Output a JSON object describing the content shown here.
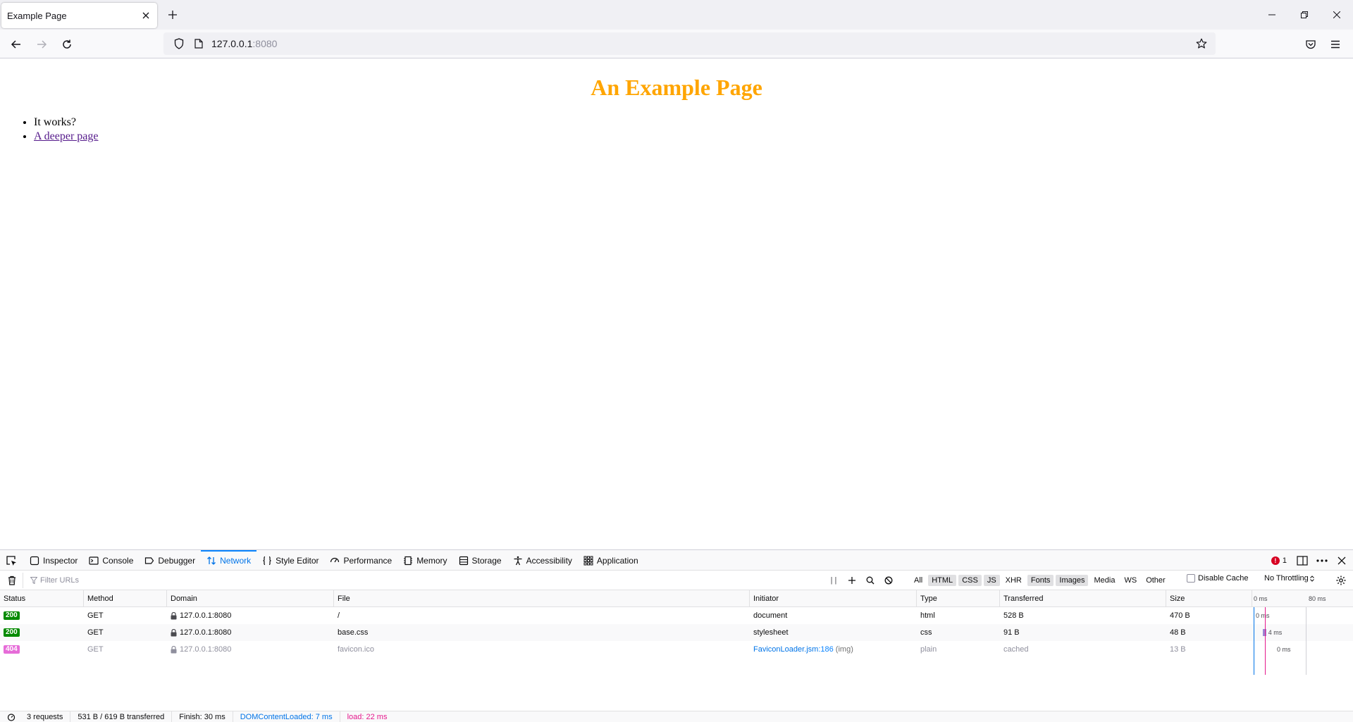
{
  "browser": {
    "tab_title": "Example Page",
    "url_host": "127.0.0.1",
    "url_port": ":8080"
  },
  "page": {
    "heading": "An Example Page",
    "items": [
      "It works?",
      "A deeper page"
    ],
    "heading_color": "#ffa500"
  },
  "devtools": {
    "tabs": [
      {
        "label": "Inspector",
        "icon": "inspector-icon"
      },
      {
        "label": "Console",
        "icon": "console-icon"
      },
      {
        "label": "Debugger",
        "icon": "debugger-icon"
      },
      {
        "label": "Network",
        "icon": "network-icon",
        "active": true
      },
      {
        "label": "Style Editor",
        "icon": "style-editor-icon"
      },
      {
        "label": "Performance",
        "icon": "performance-icon"
      },
      {
        "label": "Memory",
        "icon": "memory-icon"
      },
      {
        "label": "Storage",
        "icon": "storage-icon"
      },
      {
        "label": "Accessibility",
        "icon": "accessibility-icon"
      },
      {
        "label": "Application",
        "icon": "application-icon"
      }
    ],
    "error_count": "1",
    "filter_placeholder": "Filter URLs",
    "pause_label": "| |",
    "type_filters": [
      {
        "label": "All",
        "checked": false
      },
      {
        "label": "HTML",
        "checked": true
      },
      {
        "label": "CSS",
        "checked": true
      },
      {
        "label": "JS",
        "checked": true
      },
      {
        "label": "XHR",
        "checked": false
      },
      {
        "label": "Fonts",
        "checked": true
      },
      {
        "label": "Images",
        "checked": true
      },
      {
        "label": "Media",
        "checked": false
      },
      {
        "label": "WS",
        "checked": false
      },
      {
        "label": "Other",
        "checked": false
      }
    ],
    "disable_cache": "Disable Cache",
    "throttling": "No Throttling",
    "columns": [
      "Status",
      "Method",
      "Domain",
      "File",
      "Initiator",
      "Type",
      "Transferred",
      "Size"
    ],
    "waterfall_header_labels": [
      "0 ms",
      "80 ms"
    ],
    "requests": [
      {
        "status": "200",
        "method": "GET",
        "domain": "127.0.0.1:8080",
        "file": "/",
        "initiator": "document",
        "initiator_line": "",
        "initiator_extra": "",
        "type": "html",
        "transferred": "528 B",
        "size": "470 B",
        "timing": "0 ms",
        "timing_ms": 0
      },
      {
        "status": "200",
        "method": "GET",
        "domain": "127.0.0.1:8080",
        "file": "base.css",
        "initiator": "stylesheet",
        "initiator_line": "",
        "initiator_extra": "",
        "type": "css",
        "transferred": "91 B",
        "size": "48 B",
        "timing": "4 ms",
        "timing_ms": 4
      },
      {
        "status": "404",
        "method": "GET",
        "domain": "127.0.0.1:8080",
        "file": "favicon.ico",
        "initiator": "FaviconLoader.jsm",
        "initiator_line": ":186",
        "initiator_extra": " (img)",
        "type": "plain",
        "transferred": "cached",
        "size": "13 B",
        "timing": "0 ms",
        "timing_ms": 0
      }
    ],
    "status_colors": {
      "200": "#058b00",
      "404": "#e66cd8"
    },
    "summary": {
      "requests": "3 requests",
      "transferred": "531 B / 619 B transferred",
      "finish": "Finish: 30 ms",
      "dom_content_loaded": "DOMContentLoaded: 7 ms",
      "load": "load: 22 ms"
    }
  }
}
